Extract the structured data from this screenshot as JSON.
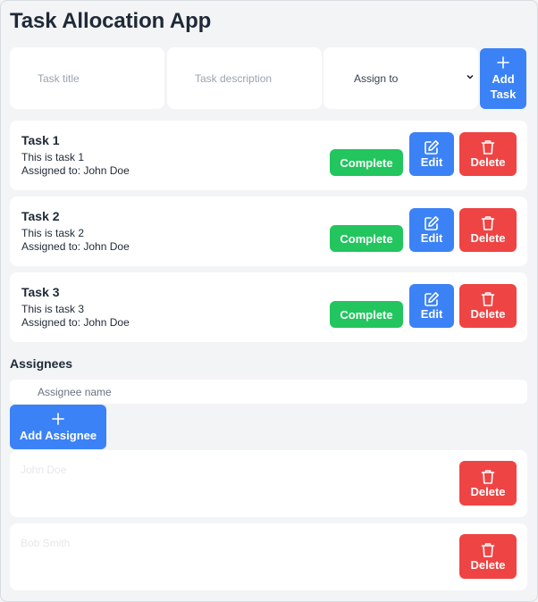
{
  "app": {
    "title": "Task Allocation App"
  },
  "form": {
    "title_placeholder": "Task title",
    "description_placeholder": "Task description",
    "assign_selected": "Assign to",
    "add_label_1": "Add",
    "add_label_2": "Task"
  },
  "tasks": [
    {
      "title": "Task 1",
      "description": "This is task 1",
      "assigned": "Assigned to: John Doe"
    },
    {
      "title": "Task 2",
      "description": "This is task 2",
      "assigned": "Assigned to: John Doe"
    },
    {
      "title": "Task 3",
      "description": "This is task 3",
      "assigned": "Assigned to: John Doe"
    }
  ],
  "task_actions": {
    "complete": "Complete",
    "edit": "Edit",
    "delete": "Delete"
  },
  "assignees_section": {
    "title": "Assignees",
    "input_placeholder": "Assignee name",
    "add_label": "Add Assignee",
    "items": [
      {
        "name": "John Doe"
      },
      {
        "name": "Bob Smith"
      }
    ],
    "delete_label": "Delete"
  },
  "colors": {
    "primary": "#3b82f6",
    "success": "#22c55e",
    "danger": "#ef4444",
    "background": "#f3f4f6"
  },
  "icons": {
    "add": "plus-icon",
    "edit": "edit-icon",
    "delete": "trash-icon",
    "dropdown": "chevron-down-icon"
  }
}
